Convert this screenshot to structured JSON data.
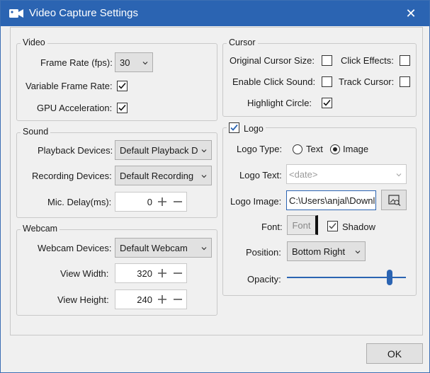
{
  "window": {
    "title": "Video Capture Settings",
    "close_glyph": "✕",
    "icon": "video-camera-icon",
    "accent": "#2b64b2"
  },
  "video": {
    "legend": "Video",
    "frame_rate_label": "Frame Rate (fps):",
    "frame_rate_value": "30",
    "variable_frame_rate_label": "Variable Frame Rate:",
    "variable_frame_rate_checked": true,
    "gpu_acceleration_label": "GPU Acceleration:",
    "gpu_acceleration_checked": true
  },
  "sound": {
    "legend": "Sound",
    "playback_label": "Playback Devices:",
    "playback_value": "Default Playback D",
    "recording_label": "Recording Devices:",
    "recording_value": "Default Recording",
    "mic_delay_label": "Mic. Delay(ms):",
    "mic_delay_value": "0"
  },
  "webcam": {
    "legend": "Webcam",
    "devices_label": "Webcam Devices:",
    "devices_value": "Default Webcam",
    "width_label": "View Width:",
    "width_value": "320",
    "height_label": "View Height:",
    "height_value": "240"
  },
  "cursor": {
    "legend": "Cursor",
    "original_size_label": "Original Cursor Size:",
    "original_size_checked": false,
    "click_effects_label": "Click Effects:",
    "click_effects_checked": false,
    "click_sound_label": "Enable Click Sound:",
    "click_sound_checked": false,
    "track_cursor_label": "Track Cursor:",
    "track_cursor_checked": false,
    "highlight_label": "Highlight Circle:",
    "highlight_checked": true
  },
  "logo": {
    "legend": "Logo",
    "enabled": true,
    "type_label": "Logo Type:",
    "type_options": [
      "Text",
      "Image"
    ],
    "type_selected": "Image",
    "text_label": "Logo Text:",
    "text_placeholder": "<date>",
    "image_label": "Logo Image:",
    "image_value": "C:\\Users\\anjal\\Downl",
    "font_label": "Font:",
    "font_button": "Font",
    "shadow_label": "Shadow",
    "shadow_checked": true,
    "position_label": "Position:",
    "position_value": "Bottom Right",
    "opacity_label": "Opacity:",
    "opacity_fraction": 0.88
  },
  "footer": {
    "ok_label": "OK"
  }
}
